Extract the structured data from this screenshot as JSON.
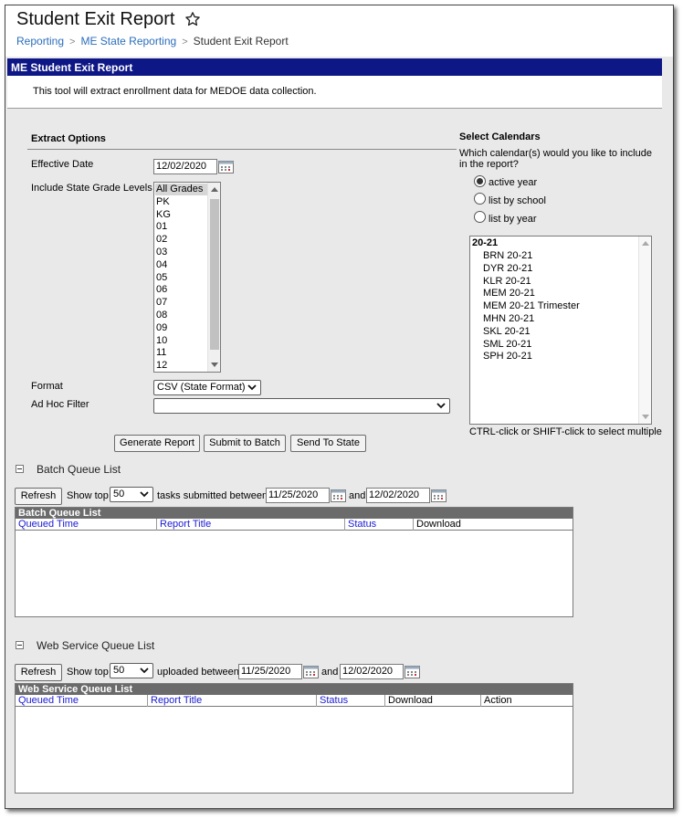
{
  "page": {
    "title": "Student Exit Report",
    "breadcrumb": [
      "Reporting",
      "ME State Reporting",
      "Student Exit Report"
    ]
  },
  "header": {
    "title": "ME Student Exit Report",
    "description": "This tool will extract enrollment data for MEDOE data collection."
  },
  "extract": {
    "section_label": "Extract Options",
    "effective_date_label": "Effective Date",
    "effective_date": "12/02/2020",
    "grade_levels_label": "Include State Grade Levels",
    "grade_levels": [
      "All Grades",
      "PK",
      "KG",
      "01",
      "02",
      "03",
      "04",
      "05",
      "06",
      "07",
      "08",
      "09",
      "10",
      "11",
      "12"
    ],
    "grade_selected": "All Grades",
    "format_label": "Format",
    "format_value": "CSV (State Format)",
    "adhoc_label": "Ad Hoc Filter",
    "adhoc_value": ""
  },
  "calendars": {
    "section_label": "Select Calendars",
    "question_line1": "Which calendar(s) would you like to include",
    "question_line2": "in the report?",
    "options": [
      "active year",
      "list by school",
      "list by year"
    ],
    "selected_option": "active year",
    "year_group": "20-21",
    "items": [
      "BRN 20-21",
      "DYR 20-21",
      "KLR 20-21",
      "MEM 20-21",
      "MEM 20-21 Trimester",
      "MHN 20-21",
      "SKL 20-21",
      "SML 20-21",
      "SPH 20-21"
    ],
    "hint": "CTRL-click or SHIFT-click to select multiple"
  },
  "actions": {
    "generate": "Generate Report",
    "batch": "Submit to Batch",
    "send": "Send To State"
  },
  "batch_queue": {
    "title": "Batch Queue List",
    "refresh": "Refresh",
    "show_top": "Show top",
    "top_value": "50",
    "between_text": "tasks submitted between",
    "from_date": "11/25/2020",
    "and_text": "and",
    "to_date": "12/02/2020",
    "table_caption": "Batch Queue List",
    "columns": [
      "Queued Time",
      "Report Title",
      "Status",
      "Download"
    ]
  },
  "web_queue": {
    "title": "Web Service Queue List",
    "refresh": "Refresh",
    "show_top": "Show top",
    "top_value": "50",
    "between_text": "uploaded between",
    "from_date": "11/25/2020",
    "and_text": "and",
    "to_date": "12/02/2020",
    "table_caption": "Web Service Queue List",
    "columns": [
      "Queued Time",
      "Report Title",
      "Status",
      "Download",
      "Action"
    ]
  },
  "icons": {
    "favorite": "star-outline-icon",
    "calendar": "calendar-icon",
    "dropdown": "chevron-down-icon",
    "collapse": "collapse-minus-icon"
  },
  "colors": {
    "header_bar": "#0e1786",
    "link": "#2a6ebb",
    "column_link": "#1a1ad4",
    "table_caption": "#6b6b6b",
    "panel": "#e9e9e9"
  }
}
